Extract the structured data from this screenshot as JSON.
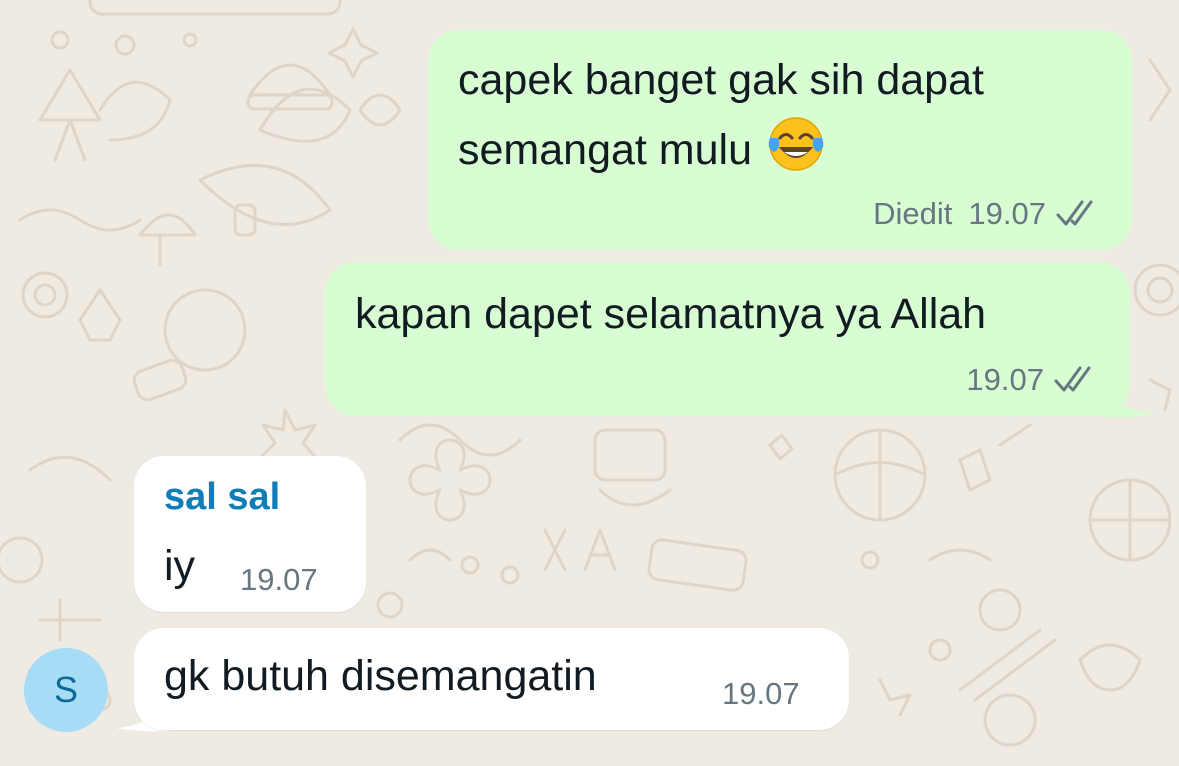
{
  "messages": [
    {
      "direction": "outgoing",
      "lines": [
        "capek banget gak sih dapat",
        "semangat mulu"
      ],
      "emoji": "face-with-tears-of-joy",
      "edited_label": "Diedit",
      "time": "19.07",
      "status": "read-double-check"
    },
    {
      "direction": "outgoing",
      "text": "kapan dapet selamatnya ya Allah",
      "time": "19.07",
      "status": "read-double-check"
    },
    {
      "direction": "incoming",
      "sender": "sal sal",
      "text": "iy",
      "time": "19.07"
    },
    {
      "direction": "incoming",
      "text": "gk butuh disemangatin",
      "time": "19.07",
      "avatar_initial": "S"
    }
  ],
  "colors": {
    "background": "#efeae2",
    "outgoing_bubble": "#d9fdd3",
    "incoming_bubble": "#ffffff",
    "sender_name": "#0f7eb8",
    "meta_text": "#667781",
    "avatar_bg": "#a6dcf5"
  }
}
